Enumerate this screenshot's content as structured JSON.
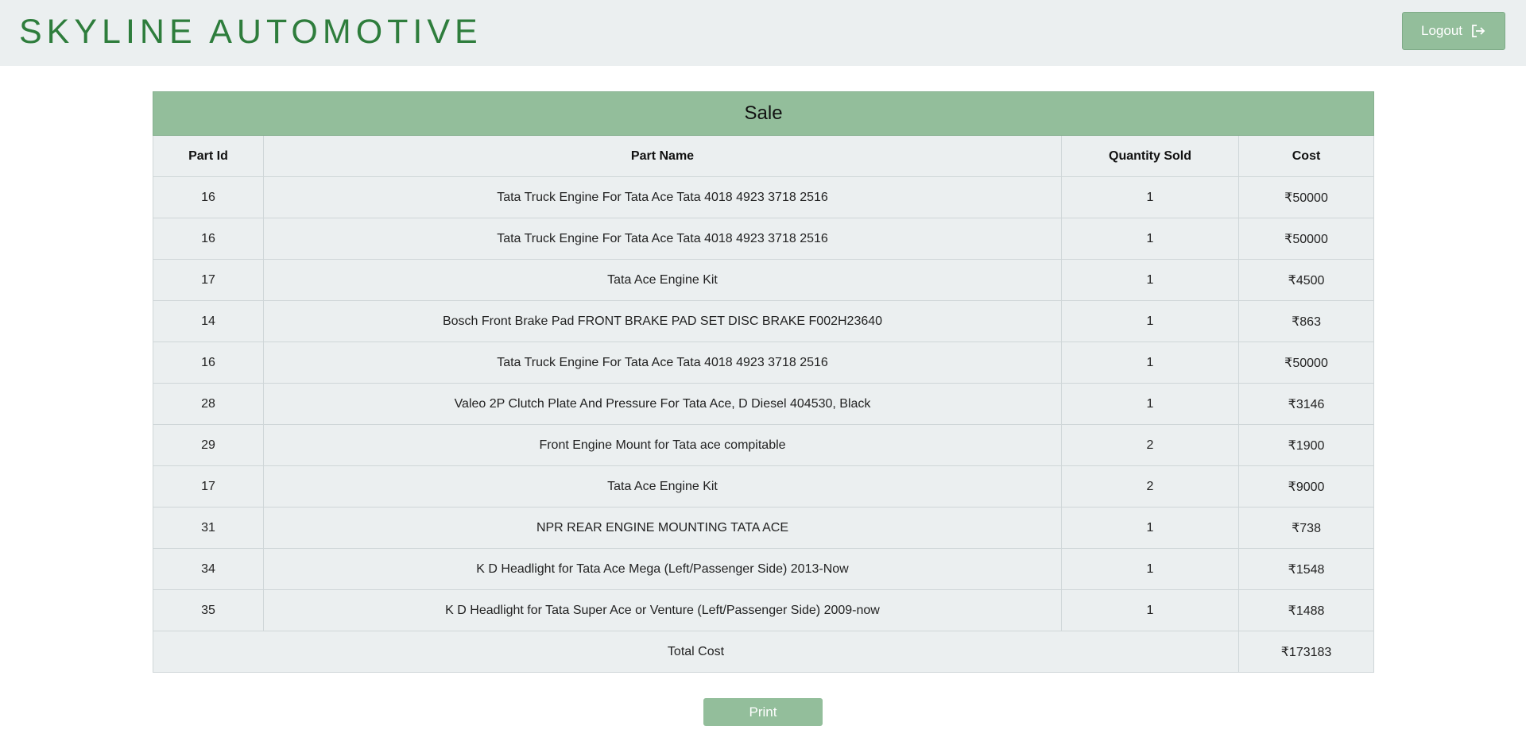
{
  "header": {
    "brand": "SKYLINE AUTOMOTIVE",
    "logout_label": "Logout",
    "logout_icon": "logout-icon"
  },
  "colors": {
    "brand_green": "#2e7d3c",
    "accent_green": "#93be9b",
    "panel_grey": "#ebeff0"
  },
  "sale": {
    "title": "Sale",
    "columns": [
      "Part Id",
      "Part Name",
      "Quantity Sold",
      "Cost"
    ],
    "currency_symbol": "₹",
    "rows": [
      {
        "part_id": "16",
        "part_name": "Tata Truck Engine For Tata Ace Tata 4018 4923 3718 2516",
        "qty": "1",
        "cost": "50000"
      },
      {
        "part_id": "16",
        "part_name": "Tata Truck Engine For Tata Ace Tata 4018 4923 3718 2516",
        "qty": "1",
        "cost": "50000"
      },
      {
        "part_id": "17",
        "part_name": "Tata Ace Engine Kit",
        "qty": "1",
        "cost": "4500"
      },
      {
        "part_id": "14",
        "part_name": "Bosch Front Brake Pad FRONT BRAKE PAD SET DISC BRAKE F002H23640",
        "qty": "1",
        "cost": "863"
      },
      {
        "part_id": "16",
        "part_name": "Tata Truck Engine For Tata Ace Tata 4018 4923 3718 2516",
        "qty": "1",
        "cost": "50000"
      },
      {
        "part_id": "28",
        "part_name": "Valeo 2P Clutch Plate And Pressure For Tata Ace, D Diesel 404530, Black",
        "qty": "1",
        "cost": "3146"
      },
      {
        "part_id": "29",
        "part_name": "Front Engine Mount for Tata ace compitable",
        "qty": "2",
        "cost": "1900"
      },
      {
        "part_id": "17",
        "part_name": "Tata Ace Engine Kit",
        "qty": "2",
        "cost": "9000"
      },
      {
        "part_id": "31",
        "part_name": "NPR REAR ENGINE MOUNTING TATA ACE",
        "qty": "1",
        "cost": "738"
      },
      {
        "part_id": "34",
        "part_name": "K D Headlight for Tata Ace Mega (Left/Passenger Side) 2013-Now",
        "qty": "1",
        "cost": "1548"
      },
      {
        "part_id": "35",
        "part_name": "K D Headlight for Tata Super Ace or Venture (Left/Passenger Side) 2009-now",
        "qty": "1",
        "cost": "1488"
      }
    ],
    "total_label": "Total Cost",
    "total_cost": "173183"
  },
  "actions": {
    "print_label": "Print"
  }
}
